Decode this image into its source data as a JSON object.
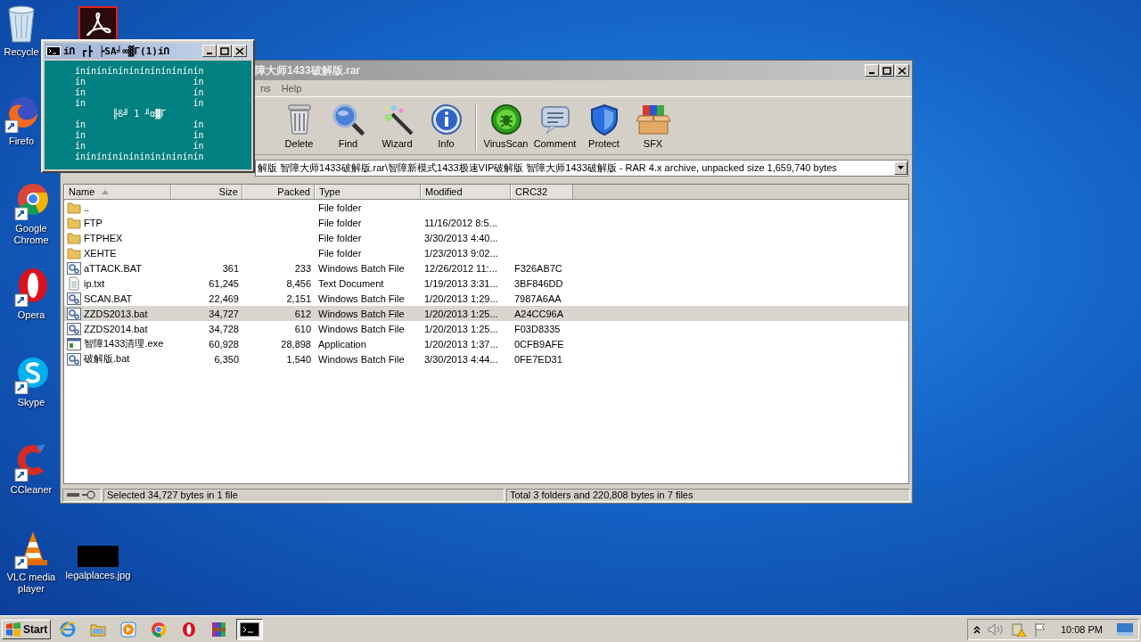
{
  "desktop_icons": [
    {
      "label": "Recycle",
      "kind": "recycle"
    },
    {
      "label": "Firefo",
      "kind": "firefox"
    },
    {
      "label": "Google Chrome",
      "kind": "chrome"
    },
    {
      "label": "Opera",
      "kind": "opera"
    },
    {
      "label": "Skype",
      "kind": "skype"
    },
    {
      "label": "CCleaner",
      "kind": "ccleaner"
    },
    {
      "label": "VLC media player",
      "kind": "vlc"
    },
    {
      "kind": "acrobat"
    },
    {
      "label": "legalplaces.jpg",
      "kind": "image"
    }
  ],
  "console": {
    "title": "íՈ ┏┣ ┝SA╛∞▓Γ(1)íՈ",
    "lines": [
      "ínínínínínínínínínínínín",
      "ín                    ín",
      "ín                    ín",
      "ín                    ín",
      "       ╟ß╝ 1 ╜α▓Γ",
      "ín                    ín",
      "ín                    ín",
      "ín                    ín",
      "ínínínínínínínínínínínín"
    ]
  },
  "archiver": {
    "title": "障大师1433破解版.rar",
    "menu": [
      "ns",
      "Help"
    ],
    "toolbar": [
      {
        "label": "Delete",
        "kind": "delete"
      },
      {
        "label": "Find",
        "kind": "find"
      },
      {
        "label": "Wizard",
        "kind": "wizard"
      },
      {
        "label": "Info",
        "kind": "info"
      },
      {
        "label": "VirusScan",
        "kind": "virus"
      },
      {
        "label": "Comment",
        "kind": "comment"
      },
      {
        "label": "Protect",
        "kind": "protect"
      },
      {
        "label": "SFX",
        "kind": "sfx"
      }
    ],
    "path": "解版 智障大师1433破解版.rar\\智障新模式1433极速VIP破解版 智障大师1433破解版 - RAR 4.x archive, unpacked size 1,659,740 bytes",
    "columns": [
      {
        "label": "Name",
        "sorted": true
      },
      {
        "label": "Size",
        "sorted": false
      },
      {
        "label": "Packed",
        "sorted": false
      },
      {
        "label": "Type",
        "sorted": false
      },
      {
        "label": "Modified",
        "sorted": false
      },
      {
        "label": "CRC32",
        "sorted": false
      }
    ],
    "rows": [
      {
        "kind": "folder",
        "name": "..",
        "size": "",
        "packed": "",
        "type": "File folder",
        "modified": "",
        "crc": "",
        "selected": false
      },
      {
        "kind": "folder",
        "name": "FTP",
        "size": "",
        "packed": "",
        "type": "File folder",
        "modified": "11/16/2012 8:5...",
        "crc": "",
        "selected": false
      },
      {
        "kind": "folder",
        "name": "FTPHEX",
        "size": "",
        "packed": "",
        "type": "File folder",
        "modified": "3/30/2013 4:40...",
        "crc": "",
        "selected": false
      },
      {
        "kind": "folder",
        "name": "XEHTE",
        "size": "",
        "packed": "",
        "type": "File folder",
        "modified": "1/23/2013 9:02...",
        "crc": "",
        "selected": false
      },
      {
        "kind": "batch",
        "name": "aTTACK.BAT",
        "size": "361",
        "packed": "233",
        "type": "Windows Batch File",
        "modified": "12/26/2012 11:...",
        "crc": "F326AB7C",
        "selected": false
      },
      {
        "kind": "text",
        "name": "ip.txt",
        "size": "61,245",
        "packed": "8,456",
        "type": "Text Document",
        "modified": "1/19/2013 3:31...",
        "crc": "3BF846DD",
        "selected": false
      },
      {
        "kind": "batch",
        "name": "SCAN.BAT",
        "size": "22,469",
        "packed": "2,151",
        "type": "Windows Batch File",
        "modified": "1/20/2013 1:29...",
        "crc": "7987A6AA",
        "selected": false
      },
      {
        "kind": "batch",
        "name": "ZZDS2013.bat",
        "size": "34,727",
        "packed": "612",
        "type": "Windows Batch File",
        "modified": "1/20/2013 1:25...",
        "crc": "A24CC96A",
        "selected": true
      },
      {
        "kind": "batch",
        "name": "ZZDS2014.bat",
        "size": "34,728",
        "packed": "610",
        "type": "Windows Batch File",
        "modified": "1/20/2013 1:25...",
        "crc": "F03D8335",
        "selected": false
      },
      {
        "kind": "app",
        "name": "智障1433清理.exe",
        "size": "60,928",
        "packed": "28,898",
        "type": "Application",
        "modified": "1/20/2013 1:37...",
        "crc": "0CFB9AFE",
        "selected": false
      },
      {
        "kind": "batch",
        "name": "破解版.bat",
        "size": "6,350",
        "packed": "1,540",
        "type": "Windows Batch File",
        "modified": "3/30/2013 4:44...",
        "crc": "0FE7ED31",
        "selected": false
      }
    ],
    "status_left": "Selected 34,727 bytes in 1 file",
    "status_right": "Total 3 folders and 220,808 bytes in 7 files"
  },
  "taskbar": {
    "start": "Start",
    "tasks": [
      {
        "kind": "ie",
        "active": false
      },
      {
        "kind": "explorer",
        "active": false
      },
      {
        "kind": "media",
        "active": false
      },
      {
        "kind": "chrome",
        "active": false
      },
      {
        "kind": "opera",
        "active": false
      },
      {
        "kind": "winrar",
        "active": false
      },
      {
        "kind": "console",
        "active": true
      }
    ],
    "clock": "10:08 PM"
  }
}
